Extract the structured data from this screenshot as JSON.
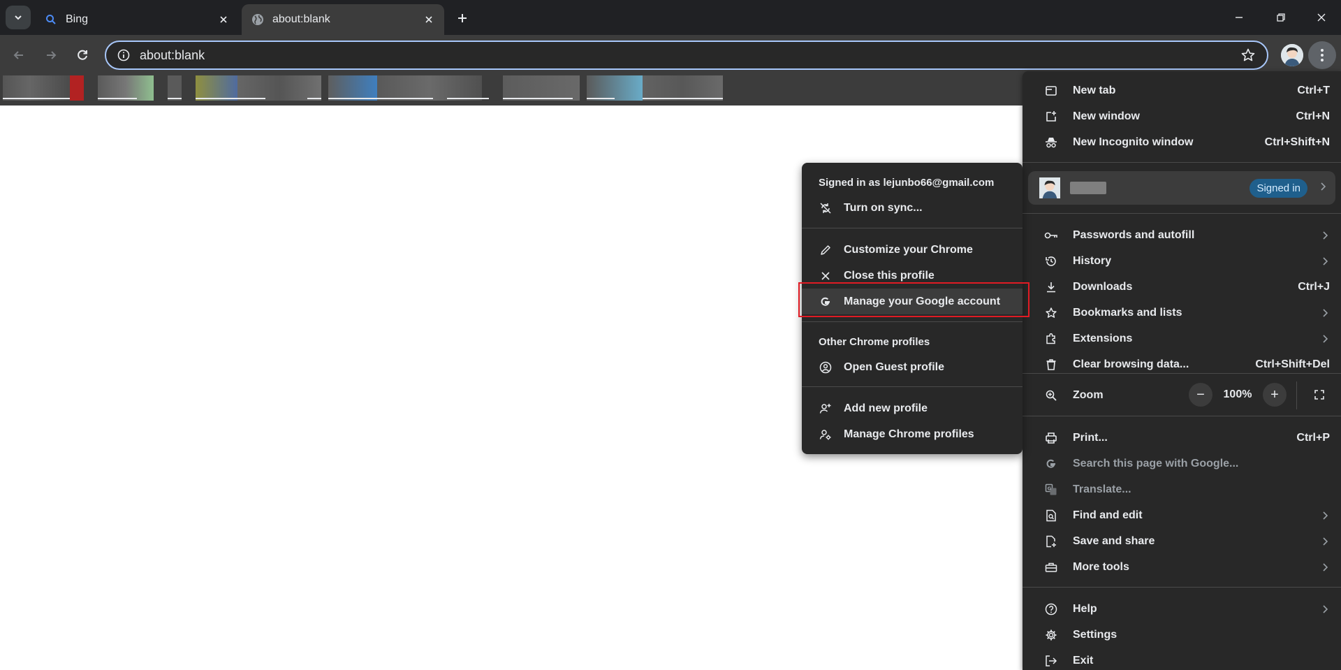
{
  "window": {
    "tabs": [
      {
        "title": "Bing",
        "icon": "search-icon",
        "active": false
      },
      {
        "title": "about:blank",
        "icon": "globe-icon",
        "active": true
      }
    ]
  },
  "toolbar": {
    "url": "about:blank"
  },
  "main_menu": {
    "new_tab": {
      "label": "New tab",
      "shortcut": "Ctrl+T"
    },
    "new_window": {
      "label": "New window",
      "shortcut": "Ctrl+N"
    },
    "new_incognito": {
      "label": "New Incognito window",
      "shortcut": "Ctrl+Shift+N"
    },
    "profile": {
      "badge": "Signed in"
    },
    "passwords": {
      "label": "Passwords and autofill"
    },
    "history": {
      "label": "History"
    },
    "downloads": {
      "label": "Downloads",
      "shortcut": "Ctrl+J"
    },
    "bookmarks": {
      "label": "Bookmarks and lists"
    },
    "extensions": {
      "label": "Extensions"
    },
    "clear_data": {
      "label": "Clear browsing data...",
      "shortcut": "Ctrl+Shift+Del"
    },
    "zoom": {
      "label": "Zoom",
      "value": "100%",
      "minus": "−",
      "plus": "+"
    },
    "print": {
      "label": "Print...",
      "shortcut": "Ctrl+P"
    },
    "search_google": {
      "label": "Search this page with Google..."
    },
    "translate": {
      "label": "Translate..."
    },
    "find_edit": {
      "label": "Find and edit"
    },
    "save_share": {
      "label": "Save and share"
    },
    "more_tools": {
      "label": "More tools"
    },
    "help": {
      "label": "Help"
    },
    "settings": {
      "label": "Settings"
    },
    "exit": {
      "label": "Exit"
    }
  },
  "profile_menu": {
    "signed_in_as": "Signed in as lejunbo66@gmail.com",
    "turn_on_sync": "Turn on sync...",
    "customize": "Customize your Chrome",
    "close_profile": "Close this profile",
    "manage_google": "Manage your Google account",
    "other_profiles_heading": "Other Chrome profiles",
    "guest_profile": "Open Guest profile",
    "add_profile": "Add new profile",
    "manage_profiles": "Manage Chrome profiles"
  },
  "colors": {
    "highlight": "#e01b24",
    "omnibox_border": "#a8c7fa",
    "menu_bg": "#282828"
  }
}
